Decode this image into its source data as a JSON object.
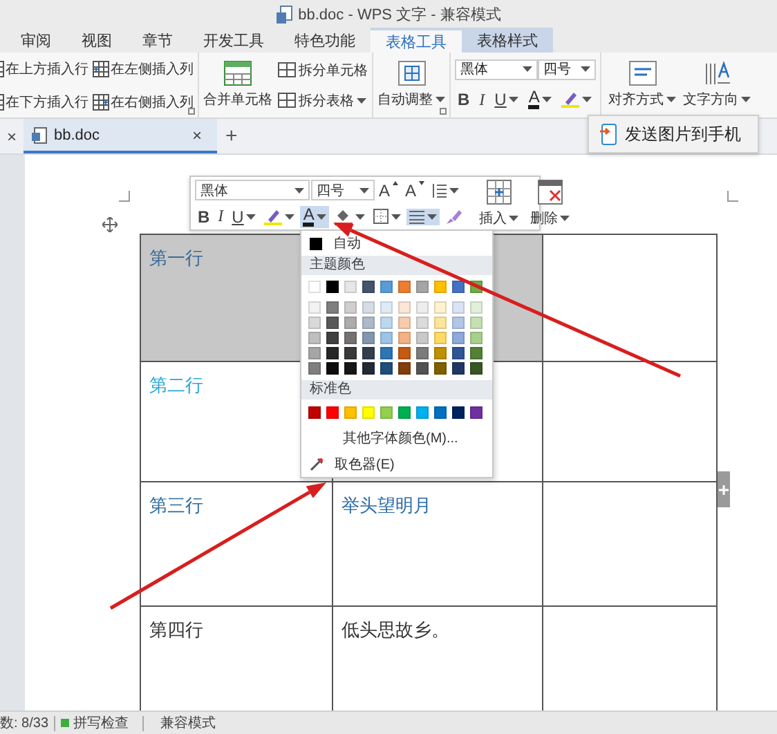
{
  "window": {
    "title": "bb.doc - WPS 文字 - 兼容模式"
  },
  "tabs": [
    {
      "label": "审阅",
      "selected": false,
      "kind": "plain"
    },
    {
      "label": "视图",
      "selected": false,
      "kind": "plain"
    },
    {
      "label": "章节",
      "selected": false,
      "kind": "plain"
    },
    {
      "label": "开发工具",
      "selected": false,
      "kind": "plain"
    },
    {
      "label": "特色功能",
      "selected": false,
      "kind": "plain"
    },
    {
      "label": "表格工具",
      "selected": true,
      "kind": "context"
    },
    {
      "label": "表格样式",
      "selected": false,
      "kind": "context"
    }
  ],
  "ribbon": {
    "insert_group": {
      "launcher": true,
      "buttons": [
        {
          "label": "在上方插入行"
        },
        {
          "label": "在左侧插入列"
        },
        {
          "label": "在下方插入行"
        },
        {
          "label": "在右侧插入列"
        }
      ]
    },
    "merge_group": {
      "large": {
        "label": "合并单元格"
      },
      "small": [
        {
          "label": "拆分单元格",
          "dropdown": false
        },
        {
          "label": "拆分表格",
          "dropdown": true
        }
      ]
    },
    "autofit_group": {
      "launcher": true,
      "button": {
        "label": "自动调整",
        "dropdown": true
      }
    },
    "font_group": {
      "font": "黑体",
      "size": "四号",
      "buttons": [
        {
          "kind": "bold",
          "label": "B",
          "dropdown": false
        },
        {
          "kind": "italic",
          "label": "I",
          "dropdown": false
        },
        {
          "kind": "underline",
          "label": "U",
          "dropdown": true
        },
        {
          "kind": "font-color",
          "label": "A",
          "dropdown": true
        },
        {
          "kind": "highlight",
          "dropdown": true
        }
      ]
    },
    "text_group": {
      "buttons": [
        {
          "kind": "align",
          "label": "对齐方式",
          "dropdown": true
        },
        {
          "kind": "direction",
          "label": "文字方向",
          "dropdown": true
        }
      ]
    }
  },
  "doc_tabs": {
    "close_all": "×",
    "tabs": [
      {
        "label": "bb.doc",
        "selected": true,
        "close": "×"
      }
    ],
    "new_tab": "+"
  },
  "send_popup": {
    "label": "发送图片到手机"
  },
  "document": {
    "table": {
      "rows": [
        {
          "cells": [
            {
              "text": "第一行",
              "color": "#3d6a96",
              "selected": true
            },
            {
              "selected": true
            },
            {
              "selected": false
            }
          ]
        },
        {
          "cells": [
            {
              "text": "第二行",
              "color": "#2aa6d6",
              "selected": false
            },
            {
              "selected": false
            },
            {
              "selected": false
            }
          ]
        },
        {
          "cells": [
            {
              "text": "第三行",
              "color": "#2d6c9e",
              "selected": false
            },
            {
              "text": "举头望明月",
              "color": "#2a6aa8",
              "selected": false
            },
            {
              "selected": false
            }
          ]
        },
        {
          "cells": [
            {
              "text": "第四行",
              "color": "#333333",
              "selected": false
            },
            {
              "text": "低头思故乡。",
              "color": "#333333",
              "selected": false
            },
            {
              "selected": false
            }
          ]
        }
      ]
    }
  },
  "mini_toolbar": {
    "font": "黑体",
    "size": "四号",
    "grow": "A",
    "shrink": "A",
    "insert": "插入",
    "delete": "删除",
    "buttons": [
      {
        "kind": "bold",
        "label": "B",
        "dropdown": false,
        "active": false
      },
      {
        "kind": "italic",
        "label": "I",
        "dropdown": false,
        "active": false
      },
      {
        "kind": "underline",
        "label": "U",
        "dropdown": true,
        "active": false
      },
      {
        "kind": "highlight",
        "dropdown": true,
        "active": false
      },
      {
        "kind": "font-color",
        "label": "A",
        "dropdown": true,
        "active": true
      },
      {
        "kind": "fill",
        "dropdown": true,
        "active": false
      },
      {
        "kind": "border",
        "dropdown": true,
        "active": false
      },
      {
        "kind": "align",
        "dropdown": true,
        "active": true
      },
      {
        "kind": "brush",
        "dropdown": false,
        "active": false
      }
    ]
  },
  "color_menu": {
    "auto": {
      "label": "自动",
      "color": "#000000"
    },
    "theme_heading": "主题颜色",
    "theme_colors": [
      {
        "color": "#ffffff"
      },
      {
        "color": "#000000"
      },
      {
        "color": "#e7e6e6"
      },
      {
        "color": "#44546a"
      },
      {
        "color": "#5b9bd5"
      },
      {
        "color": "#ed7d31"
      },
      {
        "color": "#a5a5a5"
      },
      {
        "color": "#ffc000"
      },
      {
        "color": "#4472c4"
      },
      {
        "color": "#70ad47"
      }
    ],
    "shade_rows": [
      {
        "swatches": [
          {
            "color": "#f2f2f2"
          },
          {
            "color": "#7f7f7f"
          },
          {
            "color": "#d0cece"
          },
          {
            "color": "#d6dce4"
          },
          {
            "color": "#deebf6"
          },
          {
            "color": "#fbe5d5"
          },
          {
            "color": "#ededed"
          },
          {
            "color": "#fff2cc"
          },
          {
            "color": "#dae3f3"
          },
          {
            "color": "#e2efd9"
          }
        ]
      },
      {
        "swatches": [
          {
            "color": "#d9d9d9"
          },
          {
            "color": "#595959"
          },
          {
            "color": "#aeabab"
          },
          {
            "color": "#adb9ca"
          },
          {
            "color": "#bdd7ee"
          },
          {
            "color": "#f7cbac"
          },
          {
            "color": "#dbdbdb"
          },
          {
            "color": "#fee599"
          },
          {
            "color": "#b4c6e7"
          },
          {
            "color": "#c5e0b3"
          }
        ]
      },
      {
        "swatches": [
          {
            "color": "#bfbfbf"
          },
          {
            "color": "#404040"
          },
          {
            "color": "#757171"
          },
          {
            "color": "#8497b0"
          },
          {
            "color": "#9dc3e6"
          },
          {
            "color": "#f4b183"
          },
          {
            "color": "#c9c9c9"
          },
          {
            "color": "#ffd965"
          },
          {
            "color": "#8eaadb"
          },
          {
            "color": "#a8d08d"
          }
        ]
      },
      {
        "swatches": [
          {
            "color": "#a6a6a6"
          },
          {
            "color": "#262626"
          },
          {
            "color": "#3a3838"
          },
          {
            "color": "#333f4f"
          },
          {
            "color": "#2e75b5"
          },
          {
            "color": "#c55a11"
          },
          {
            "color": "#7b7b7b"
          },
          {
            "color": "#bf9000"
          },
          {
            "color": "#2f5496"
          },
          {
            "color": "#538135"
          }
        ]
      },
      {
        "swatches": [
          {
            "color": "#808080"
          },
          {
            "color": "#0d0d0d"
          },
          {
            "color": "#171616"
          },
          {
            "color": "#222a35"
          },
          {
            "color": "#1f4e79"
          },
          {
            "color": "#833c0b"
          },
          {
            "color": "#525252"
          },
          {
            "color": "#7f6000"
          },
          {
            "color": "#1f3864"
          },
          {
            "color": "#375623"
          }
        ]
      }
    ],
    "standard_heading": "标准色",
    "standard_colors": [
      {
        "color": "#c00000"
      },
      {
        "color": "#ff0000"
      },
      {
        "color": "#ffc000"
      },
      {
        "color": "#ffff00"
      },
      {
        "color": "#92d050"
      },
      {
        "color": "#00b050"
      },
      {
        "color": "#00b0f0"
      },
      {
        "color": "#0070c0"
      },
      {
        "color": "#002060"
      },
      {
        "color": "#7030a0"
      }
    ],
    "more": "其他字体颜色(M)...",
    "eyedropper": "取色器(E)"
  },
  "status_bar": {
    "word_count": "数: 8/33",
    "spell_check": {
      "label": "拼写检查",
      "on": true
    },
    "mode": "兼容模式"
  },
  "annotations": [
    {
      "kind": "arrow"
    },
    {
      "kind": "arrow"
    }
  ]
}
